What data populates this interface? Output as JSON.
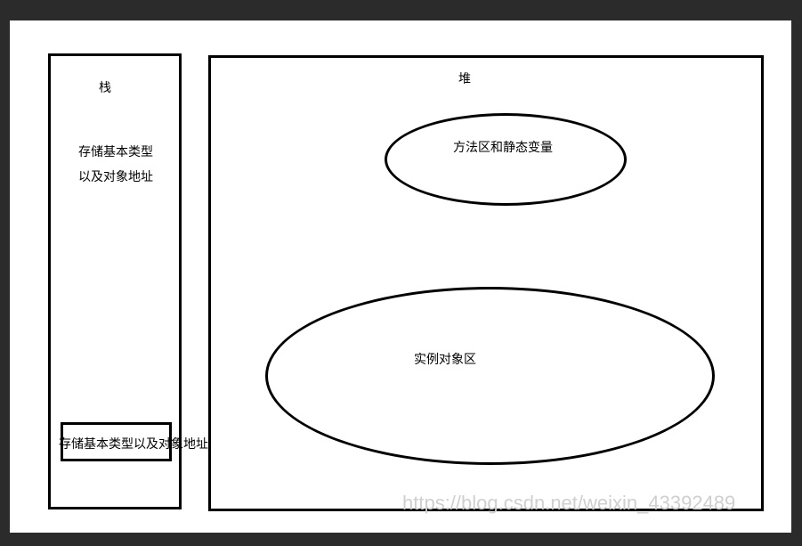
{
  "stack": {
    "title": "栈",
    "desc_line1": "存储基本类型",
    "desc_line2": "以及对象地址",
    "slot_label": "存储基本类型以及对象地址"
  },
  "heap": {
    "title": "堆",
    "method_area": "方法区和静态变量",
    "instance_area": "实例对象区"
  },
  "watermark": "https://blog.csdn.net/weixin_43392489"
}
